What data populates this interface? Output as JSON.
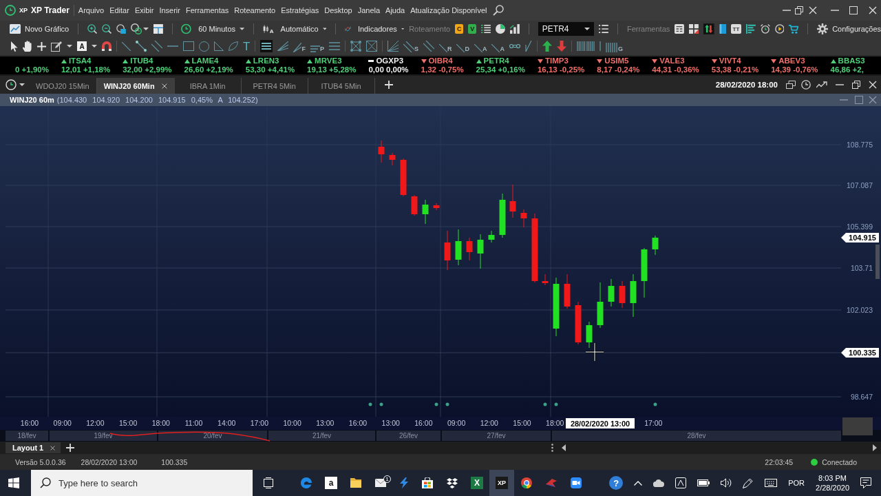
{
  "title_bar": {
    "logo": "XP",
    "app_name": "XP Trader",
    "menu": [
      "Arquivo",
      "Editar",
      "Exibir",
      "Inserir",
      "Ferramentas",
      "Roteamento",
      "Estratégias",
      "Desktop",
      "Janela",
      "Ajuda",
      "Atualização Disponível"
    ]
  },
  "toolbar": {
    "new_chart": "Novo Gráfico",
    "interval": "60 Minutos",
    "chart_type_mark": "A",
    "chart_type": "Automático",
    "indicators": "Indicadores",
    "routing": {
      "label": "Roteamento",
      "disabled": true
    },
    "order_buttons": [
      {
        "kind": "buy",
        "label": "C"
      },
      {
        "kind": "sell",
        "label": "V"
      }
    ],
    "symbol": "PETR4",
    "tools": {
      "label": "Ferramentas",
      "disabled": true
    },
    "text_button": "TT",
    "settings": "Configurações"
  },
  "drawing_tool_letters": [
    "A",
    "T",
    "F",
    "P",
    "S",
    "R",
    "D",
    "A",
    "A",
    "G"
  ],
  "ticker": [
    {
      "kind": "up",
      "quote": "0 +1,90%"
    },
    {
      "kind": "up",
      "symbol": "ITSA4",
      "quote": "12,01 +1,18%"
    },
    {
      "kind": "up",
      "symbol": "ITUB4",
      "quote": "32,00 +2,99%"
    },
    {
      "kind": "up",
      "symbol": "LAME4",
      "quote": "26,60 +2,19%"
    },
    {
      "kind": "up",
      "symbol": "LREN3",
      "quote": "53,30 +4,41%"
    },
    {
      "kind": "up",
      "symbol": "MRVE3",
      "quote": "19,13 +5,28%"
    },
    {
      "kind": "flat",
      "symbol": "OGXP3",
      "quote": "0,00 0,00%"
    },
    {
      "kind": "down",
      "symbol": "OIBR4",
      "quote": "1,32 -0,75%"
    },
    {
      "kind": "up",
      "symbol": "PETR4",
      "quote": "25,34 +0,16%"
    },
    {
      "kind": "down",
      "symbol": "TIMP3",
      "quote": "16,13 -0,25%"
    },
    {
      "kind": "down",
      "symbol": "USIM5",
      "quote": "8,17 -0,24%"
    },
    {
      "kind": "down",
      "symbol": "VALE3",
      "quote": "44,31 -0,36%"
    },
    {
      "kind": "down",
      "symbol": "VIVT4",
      "quote": "53,38 -0,21%"
    },
    {
      "kind": "down",
      "symbol": "ABEV3",
      "quote": "14,39 -0,76%"
    },
    {
      "kind": "up",
      "symbol": "BBAS3",
      "quote": "46,86 +2,"
    }
  ],
  "chart_tabs": [
    {
      "label": "WDOJ20 15Min",
      "selected": false
    },
    {
      "label": "WINJ20 60Min",
      "selected": true
    },
    {
      "label": "IBRA 1Min",
      "selected": false
    },
    {
      "label": "PETR4 5Min",
      "selected": false
    },
    {
      "label": "ITUB4 5Min",
      "selected": false
    }
  ],
  "chart_window": {
    "datetime": "28/02/2020 18:00",
    "title": "WINJ20 60m",
    "ohlc": "(104.430 104.920 104.200 104.915 0,45% A 104.252)",
    "price_axis": [
      "108.775",
      "107.087",
      "105.399",
      "103.71",
      "102.023",
      "98.647"
    ],
    "price_tags": [
      "104.915",
      "100.335"
    ],
    "time_axis": [
      "16:00",
      "09:00",
      "12:00",
      "15:00",
      "18:00",
      "11:00",
      "14:00",
      "17:00",
      "10:00",
      "13:00",
      "16:00",
      "13:00",
      "16:00",
      "09:00",
      "12:00",
      "15:00",
      "18:00",
      "17:00"
    ],
    "cursor_time": "28/02/2020 13:00",
    "date_axis": [
      "18/fev",
      "19/fev",
      "20/fev",
      "21/fev",
      "26/fev",
      "27/fev",
      "28/fev"
    ]
  },
  "layout_tabs": [
    {
      "label": "Layout 1",
      "selected": true
    }
  ],
  "status_bar": {
    "version": "Versão 5.0.0.36",
    "datetime": "28/02/2020 13:00",
    "price": "100.335",
    "clock": "22:03:45",
    "connection": {
      "label": "Conectado",
      "connected": true
    }
  },
  "taskbar": {
    "search": {
      "placeholder": "Type here to search"
    },
    "apps": [
      {
        "kind": "browser",
        "selected": false
      },
      {
        "kind": "shop",
        "label": "a",
        "selected": false
      },
      {
        "kind": "folder",
        "selected": false
      },
      {
        "kind": "mail",
        "badge": "1",
        "selected": false
      },
      {
        "kind": "bolt",
        "selected": false
      },
      {
        "kind": "store",
        "selected": false
      },
      {
        "kind": "boxes",
        "selected": false
      },
      {
        "kind": "sheet",
        "label": "X",
        "selected": false
      },
      {
        "kind": "trader",
        "label": "XP",
        "selected": true
      },
      {
        "kind": "chrome",
        "selected": false
      },
      {
        "kind": "wing",
        "selected": false
      },
      {
        "kind": "video",
        "selected": false
      }
    ],
    "help_mark": "?",
    "language": "POR",
    "time": "8:03 PM",
    "date": "2/28/2020"
  }
}
